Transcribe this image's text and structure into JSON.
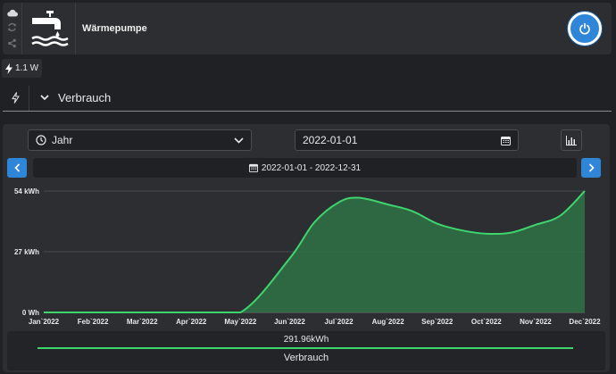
{
  "device": {
    "name": "Wärmepumpe",
    "power_reading": "1.1 W"
  },
  "section": {
    "label": "Verbrauch"
  },
  "controls": {
    "period": "Jahr",
    "date": "2022-01-01",
    "range_label": "2022-01-01 - 2022-12-31"
  },
  "colors": {
    "accent": "#2f86d8",
    "series": "#3ed46e",
    "area": "#2f6f45"
  },
  "chart_data": {
    "type": "area",
    "categories": [
      "Jan`2022",
      "Feb`2022",
      "Mar`2022",
      "Apr`2022",
      "May`2022",
      "Jun`2022",
      "Jul`2022",
      "Aug`2022",
      "Sep`2022",
      "Oct`2022",
      "Nov`2022",
      "Dec`2022"
    ],
    "y_ticks": [
      "0 Wh",
      "27 kWh",
      "54 kWh"
    ],
    "ylim": [
      0,
      54
    ],
    "grid": true,
    "series": [
      {
        "name": "Verbrauch",
        "points": [
          [
            0,
            0
          ],
          [
            1,
            0
          ],
          [
            2,
            0
          ],
          [
            3,
            0
          ],
          [
            4,
            0
          ],
          [
            5,
            24
          ],
          [
            5.5,
            40
          ],
          [
            6,
            49
          ],
          [
            6.4,
            51
          ],
          [
            7,
            48
          ],
          [
            7.5,
            45
          ],
          [
            8,
            39.5
          ],
          [
            8.5,
            36.5
          ],
          [
            9,
            35
          ],
          [
            9.5,
            35.5
          ],
          [
            10,
            39
          ],
          [
            10.5,
            43
          ],
          [
            11,
            54
          ]
        ],
        "total": "291.96kWh"
      }
    ]
  }
}
